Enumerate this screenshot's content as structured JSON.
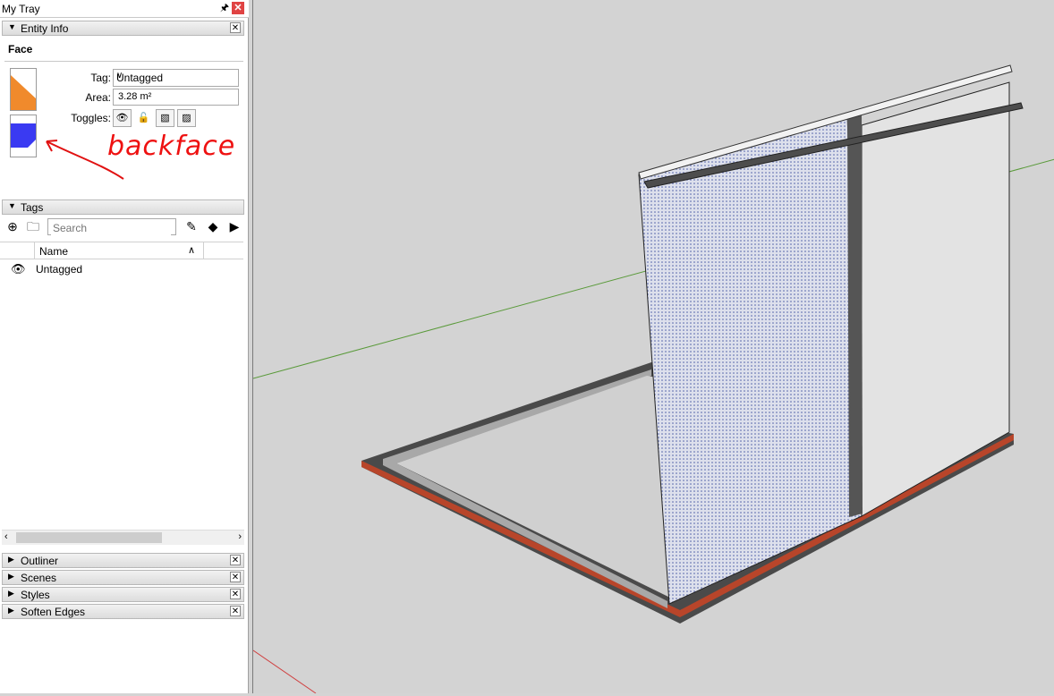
{
  "tray": {
    "title": "My Tray",
    "pin_icon": "pin-icon",
    "close_icon": "close-icon"
  },
  "entity_info": {
    "header": "Entity Info",
    "entity_type": "Face",
    "tag_label": "Tag:",
    "tag_value": "Untagged",
    "area_label": "Area:",
    "area_value": "3.28 m²",
    "toggles_label": "Toggles:",
    "front_color": "#f08a2c",
    "back_color": "#3a3af2"
  },
  "annotation": {
    "text": "backface",
    "color": "#e11111"
  },
  "tags": {
    "header": "Tags",
    "search_placeholder": "Search",
    "column_name": "Name",
    "rows": [
      {
        "name": "Untagged",
        "visible": true
      }
    ]
  },
  "collapsed_panels": [
    {
      "label": "Outliner"
    },
    {
      "label": "Scenes"
    },
    {
      "label": "Styles"
    },
    {
      "label": "Soften Edges"
    }
  ],
  "viewport": {
    "background": "#d3d3d3"
  }
}
